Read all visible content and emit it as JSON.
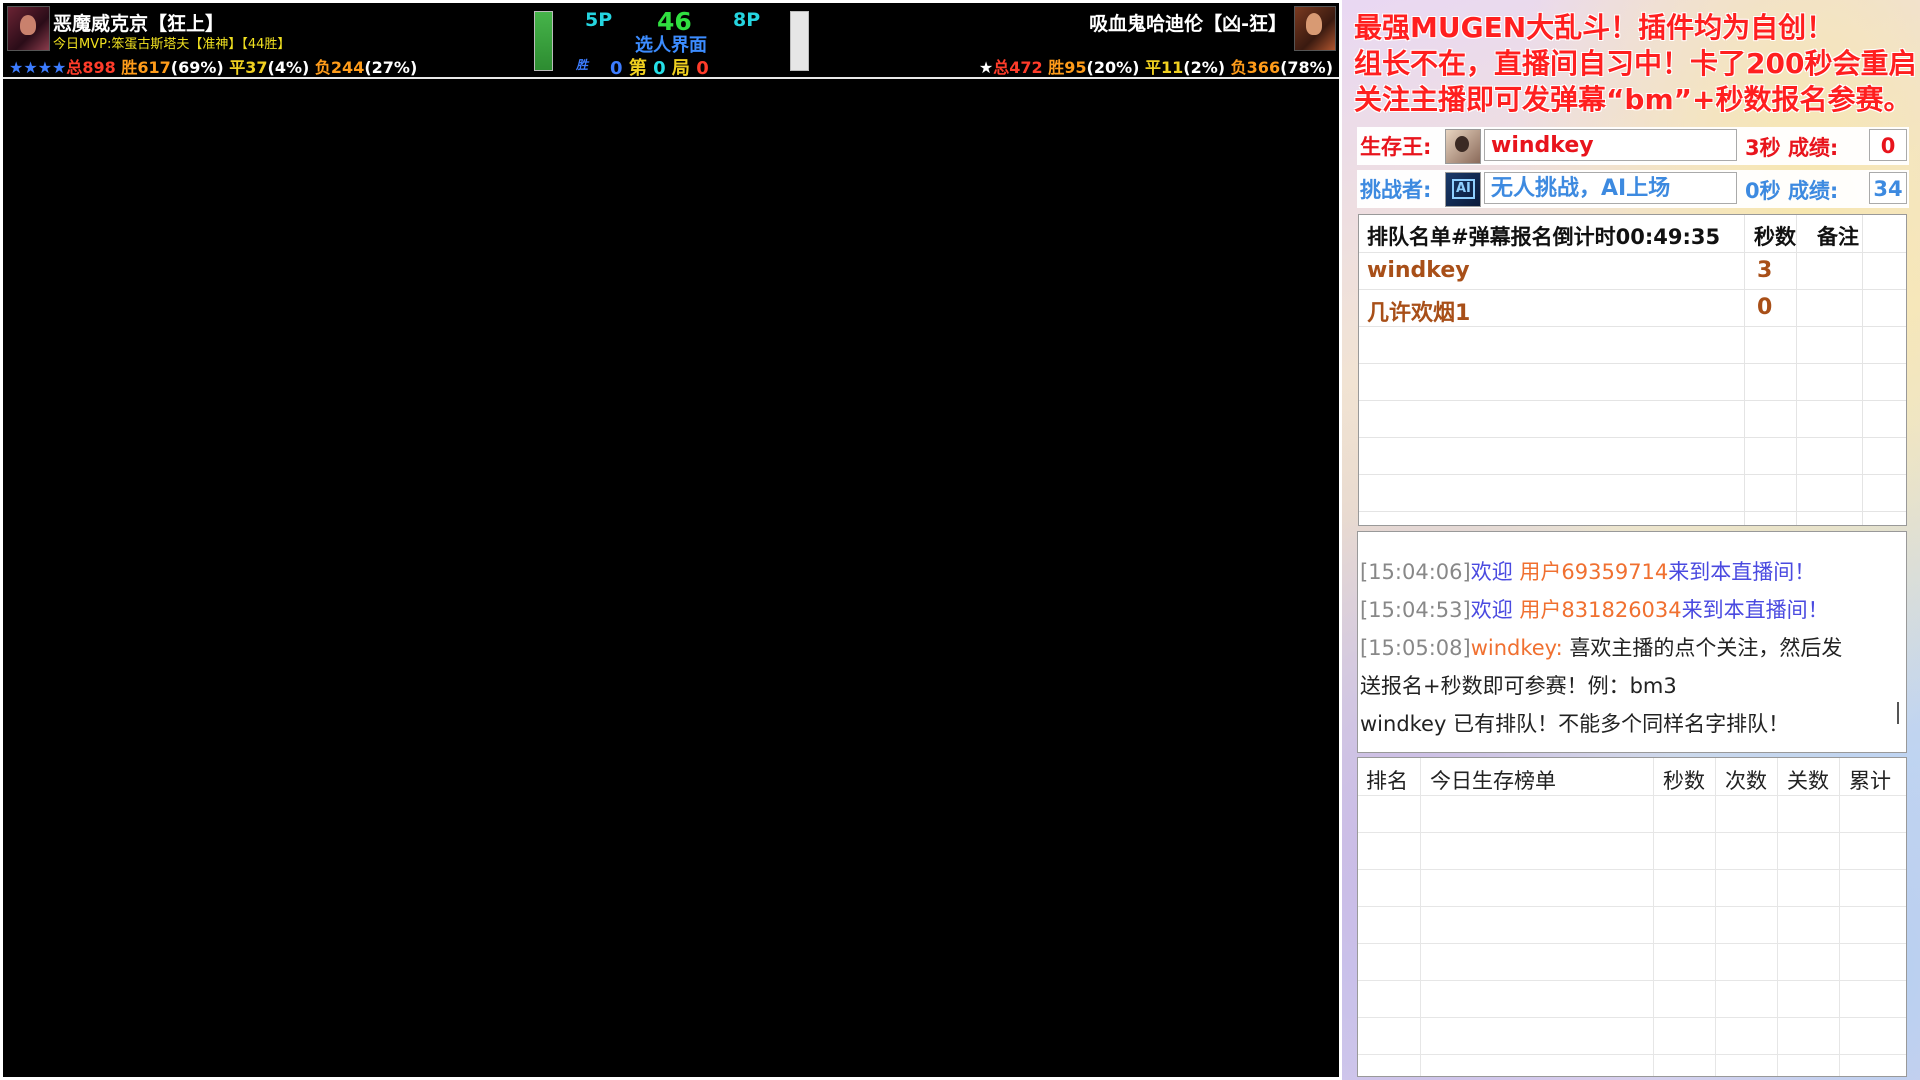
{
  "game": {
    "p1": {
      "name": "恶魔威克京【狂上】",
      "mvp": "今日MVP:笨蛋古斯塔夫【准神】【44胜】",
      "stars": "★★★★",
      "total": "总898",
      "wins": "胜617",
      "wins_pct": "(69%)",
      "draws": "平37",
      "draws_pct": "(4%)",
      "losses": "负244",
      "losses_pct": "(27%)"
    },
    "p2": {
      "name": "吸血鬼哈迪伦【凶-狂】",
      "stars": "★",
      "total": "总472",
      "wins": "胜95",
      "wins_pct": "(20%)",
      "draws": "平11",
      "draws_pct": "(2%)",
      "losses": "负366",
      "losses_pct": "(78%)"
    },
    "center": {
      "left_slot": "5P",
      "timer": "46",
      "right_slot": "8P",
      "status": "选人界面",
      "win_label": "胜",
      "left_wins": "0",
      "round_prefix": "第",
      "round": "0",
      "round_suffix": "局",
      "right_wins": "0"
    }
  },
  "panel": {
    "banners": [
      "最强MUGEN大乱斗！插件均为自创！",
      "组长不在，直播间自习中！卡了200秒会重启",
      "关注主播即可发弹幕“bm”+秒数报名参赛。"
    ],
    "king": {
      "label": "生存王:",
      "name": "windkey",
      "seconds": "3秒",
      "score_label": "成绩:",
      "score": "0"
    },
    "challenger": {
      "label": "挑战者:",
      "name": "无人挑战，AI上场",
      "seconds": "0秒",
      "score_label": "成绩:",
      "score": "34"
    },
    "queue": {
      "headers": [
        "排队名单#弹幕报名倒计时00:49:35",
        "秒数",
        "备注"
      ],
      "rows": [
        {
          "name": "windkey",
          "seconds": "3",
          "note": ""
        },
        {
          "name": "几许欢烟1",
          "seconds": "0",
          "note": ""
        }
      ]
    },
    "chat": {
      "lines": [
        {
          "time": "[15:04:06]",
          "pre": "欢迎 ",
          "user": "用户69359714",
          "post": "来到本直播间！"
        },
        {
          "time": "[15:04:53]",
          "pre": "欢迎 ",
          "user": "用户831826034",
          "post": "来到本直播间！"
        },
        {
          "time": "[15:05:08]",
          "pre": "",
          "user": "windkey:",
          "post": " 喜欢主播的点个关注，然后发"
        },
        {
          "time": "",
          "pre": "",
          "user": "",
          "post": "送报名+秒数即可参赛！例：bm3"
        },
        {
          "time": "",
          "pre": "",
          "user": "",
          "post": "windkey 已有排队！不能多个同样名字排队！"
        }
      ]
    },
    "ranking": {
      "headers": [
        "排名",
        "今日生存榜单",
        "秒数",
        "次数",
        "关数",
        "累计"
      ]
    }
  }
}
